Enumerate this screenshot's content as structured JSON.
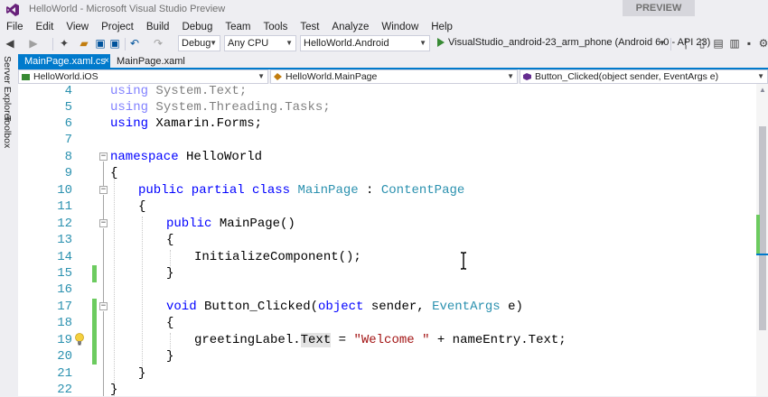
{
  "window": {
    "title": "HelloWorld - Microsoft Visual Studio Preview",
    "badge": "PREVIEW"
  },
  "menu": [
    "File",
    "Edit",
    "View",
    "Project",
    "Build",
    "Debug",
    "Team",
    "Tools",
    "Test",
    "Analyze",
    "Window",
    "Help"
  ],
  "toolbar": {
    "configuration": "Debug",
    "platform": "Any CPU",
    "startup_project": "HelloWorld.Android",
    "run_target": "VisualStudio_android-23_arm_phone (Android 6.0 - API 23)"
  },
  "side_panel": {
    "server_explorer": "Server Explorer",
    "toolbox": "Toolbox"
  },
  "tabs": {
    "active": "MainPage.xaml.cs",
    "inactive": "MainPage.xaml",
    "close_glyph": "×"
  },
  "navbar": {
    "project": "HelloWorld.iOS",
    "type": "HelloWorld.MainPage",
    "member": "Button_Clicked(object sender, EventArgs e)"
  },
  "editor": {
    "line_numbers": [
      "4",
      "5",
      "6",
      "7",
      "8",
      "9",
      "10",
      "11",
      "12",
      "13",
      "14",
      "15",
      "16",
      "17",
      "18",
      "19",
      "20",
      "21",
      "22"
    ],
    "lines": {
      "l4_using": "using",
      "l4_ns": " System.Text;",
      "l5_using": "using",
      "l5_ns": " System.Threading.Tasks;",
      "l6_using": "using",
      "l6_ns": " Xamarin.Forms;",
      "l8_kw": "namespace",
      "l8_name": " HelloWorld",
      "l9": "{",
      "l10_kw": "public partial class",
      "l10_name": "MainPage",
      "l10_colon": " : ",
      "l10_base": "ContentPage",
      "l11": "{",
      "l12_kw": "public",
      "l12_rest": " MainPage()",
      "l13": "{",
      "l14": "InitializeComponent();",
      "l15": "}",
      "l17_kw": "void",
      "l17_name": " Button_Clicked(",
      "l17_obj": "object",
      "l17_mid": " sender, ",
      "l17_type": "EventArgs",
      "l17_end": " e)",
      "l18": "{",
      "l19_a": "greetingLabel.",
      "l19_text": "Text",
      "l19_b": " = ",
      "l19_str": "\"Welcome \"",
      "l19_c": " + nameEntry.Text;",
      "l20": "}",
      "l21": "}",
      "l22": "}"
    },
    "fold_glyph": "−"
  },
  "colors": {
    "accent": "#007ACC",
    "keyword": "#0000FF",
    "type": "#2B91AF",
    "string": "#A31515",
    "change_marker": "#6CCB5F"
  }
}
